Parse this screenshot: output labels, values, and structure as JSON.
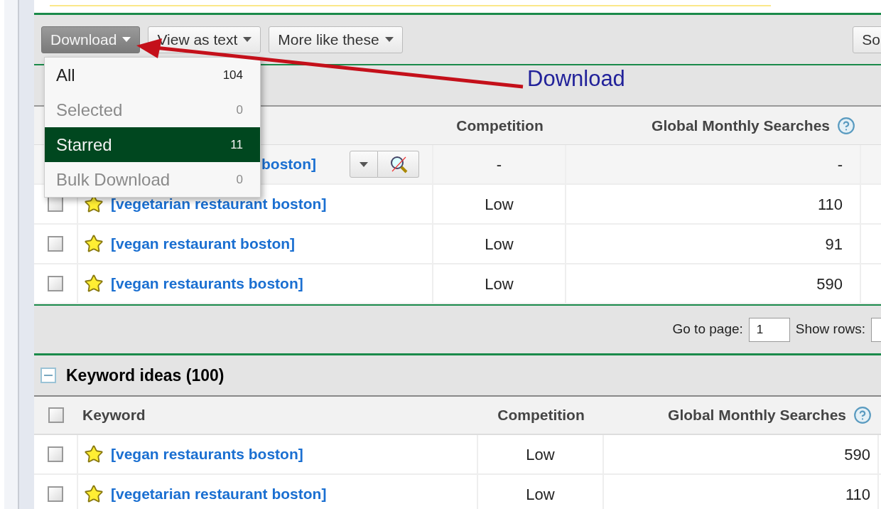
{
  "toolbar": {
    "buttons": [
      {
        "label": "Download",
        "kind": "menu",
        "active": true
      },
      {
        "label": "View as text",
        "kind": "menu",
        "active": false
      },
      {
        "label": "More like these",
        "kind": "menu",
        "active": false
      },
      {
        "label": "So",
        "kind": "plain",
        "active": false
      }
    ]
  },
  "download_menu": {
    "items": [
      {
        "label": "All",
        "count": "104",
        "selected": false,
        "disabled": false
      },
      {
        "label": "Selected",
        "count": "0",
        "selected": false,
        "disabled": true
      },
      {
        "label": "Starred",
        "count": "11",
        "selected": true,
        "disabled": false
      },
      {
        "label": "Bulk Download",
        "count": "0",
        "selected": false,
        "disabled": true
      }
    ]
  },
  "annotation": {
    "label": "Download"
  },
  "search_terms": {
    "columns": [
      "Competition",
      "Global Monthly Searches"
    ],
    "rows": [
      {
        "kind": "summary",
        "keyword": "boston]",
        "competition": "-",
        "searches": "-"
      },
      {
        "kind": "keyword",
        "keyword": "[vegetarian restaurant boston]",
        "competition": "Low",
        "searches": "110",
        "checked": false
      },
      {
        "kind": "keyword",
        "keyword": "[vegan restaurant boston]",
        "competition": "Low",
        "searches": "91",
        "checked": false
      },
      {
        "kind": "keyword",
        "keyword": "[vegan restaurants boston]",
        "competition": "Low",
        "searches": "590",
        "checked": false
      }
    ]
  },
  "pager": {
    "go_to_page_label": "Go to page:",
    "page": "1",
    "show_rows_label": "Show rows:"
  },
  "keyword_ideas": {
    "title": "Keyword ideas (100)",
    "expanded": true,
    "columns": [
      "Keyword",
      "Competition",
      "Global Monthly Searches"
    ],
    "all_checked": false,
    "rows": [
      {
        "keyword": "[vegan restaurants boston]",
        "competition": "Low",
        "searches": "590",
        "checked": false
      },
      {
        "keyword": "[vegetarian restaurant boston]",
        "competition": "Low",
        "searches": "110",
        "checked": false
      }
    ]
  }
}
